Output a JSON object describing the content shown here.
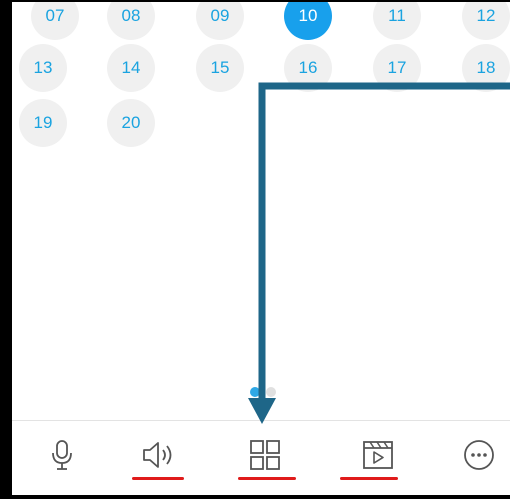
{
  "calendar": {
    "row1": [
      "07",
      "08",
      "09",
      "10",
      "11",
      "12"
    ],
    "row2": [
      "13",
      "14",
      "15",
      "16",
      "17",
      "18"
    ],
    "row3": [
      "19",
      "20"
    ],
    "selected_day": "10"
  },
  "pager": {
    "active_index": 0,
    "count": 2
  },
  "toolbar": {
    "icons": [
      "microphone-icon",
      "speaker-icon",
      "grid-icon",
      "video-clip-icon",
      "more-icon"
    ],
    "highlighted": [
      "speaker-icon",
      "grid-icon",
      "video-clip-icon"
    ]
  },
  "colors": {
    "accent": "#18a0ec",
    "day_text": "#1aa3e0",
    "highlight_underline": "#e01b1b",
    "annotation_arrow": "#1e6688"
  }
}
